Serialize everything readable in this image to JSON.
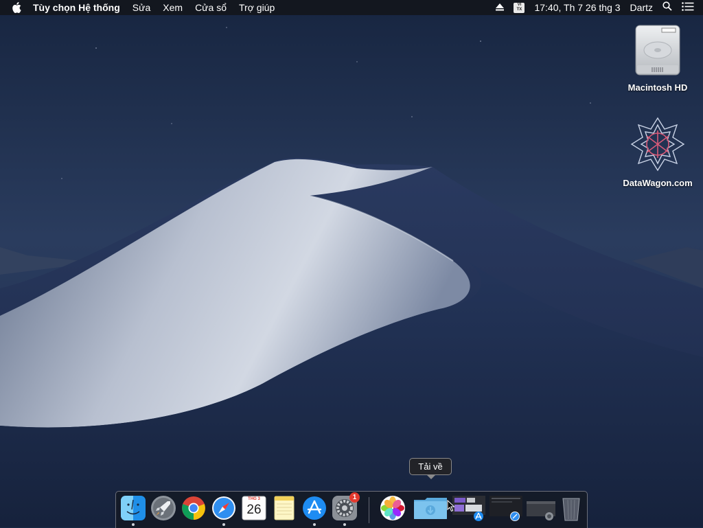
{
  "menubar": {
    "app_name": "Tùy chọn Hệ thống",
    "menus": [
      "Sửa",
      "Xem",
      "Cửa sổ",
      "Trợ giúp"
    ],
    "input_source": {
      "line1": "VI",
      "line2": "TX"
    },
    "clock": "17:40, Th 7 26 thg 3",
    "user": "Dartz"
  },
  "desktop": {
    "icons": [
      {
        "label": "Macintosh HD",
        "icon": "hard-drive-icon"
      },
      {
        "label": "DataWagon.com",
        "icon": "datawagon-logo-icon"
      }
    ]
  },
  "dock": {
    "tooltip": "Tải về",
    "calendar": {
      "month": "THG 3",
      "day": "26"
    },
    "settings_badge": "1",
    "items": [
      {
        "name": "finder",
        "running": true
      },
      {
        "name": "launchpad",
        "running": false
      },
      {
        "name": "chrome",
        "running": false
      },
      {
        "name": "safari",
        "running": true
      },
      {
        "name": "calendar",
        "running": false
      },
      {
        "name": "notes",
        "running": false
      },
      {
        "name": "app-store",
        "running": true
      },
      {
        "name": "system-preferences",
        "running": true
      },
      {
        "name": "photos",
        "running": false
      },
      {
        "name": "downloads-folder",
        "running": false
      },
      {
        "name": "minimized-window-1",
        "running": false
      },
      {
        "name": "minimized-window-2",
        "running": false
      },
      {
        "name": "minimized-window-3",
        "running": false
      },
      {
        "name": "trash",
        "running": false
      }
    ]
  },
  "colors": {
    "sky_top": "#1a2a46",
    "sky_bottom": "#2c3f63",
    "dune_light": "#c9d0dd",
    "dune_shadow": "#1f2c4c",
    "badge": "#e33a2f"
  }
}
